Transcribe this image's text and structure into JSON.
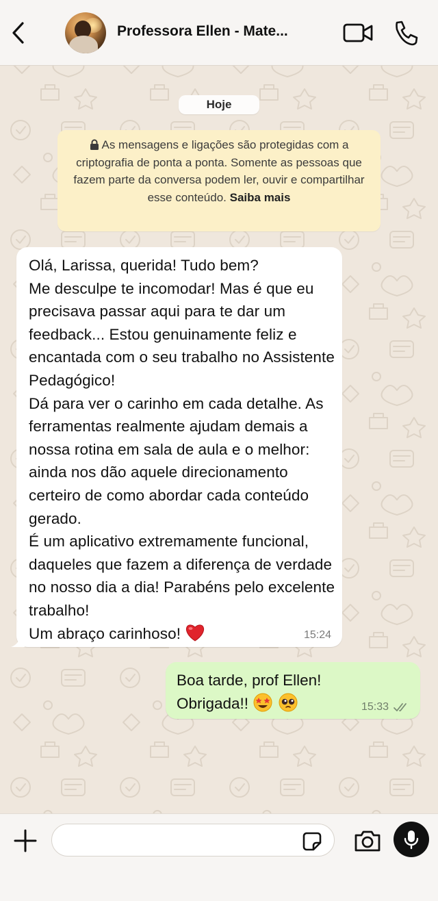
{
  "header": {
    "contact_name": "Professora Ellen - Mate...",
    "icons": [
      "back-arrow-icon",
      "video-call-icon",
      "phone-icon"
    ]
  },
  "chat": {
    "date_label": "Hoje",
    "encryption_notice": "As mensagens e ligações são protegidas com a criptografia de ponta a ponta. Somente as pessoas que fazem parte da conversa podem ler, ouvir e compartilhar esse conteúdo.",
    "encryption_link": "Saiba mais",
    "messages": [
      {
        "direction": "incoming",
        "text": "Olá, Larissa, querida! Tudo bem?\nMe desculpe te incomodar! Mas é que eu precisava passar aqui para te dar um feedback... Estou genuinamente feliz e encantada com o seu trabalho no Assistente Pedagógico!\nDá para ver o carinho em cada detalhe. As ferramentas realmente ajudam demais a nossa rotina em sala de aula e o melhor: ainda nos dão aquele direcionamento certeiro de como abordar cada conteúdo gerado.\nÉ um aplicativo extremamente funcional, daqueles que fazem a diferença de verdade no nosso dia a dia! Parabéns pelo excelente trabalho!\nUm abraço carinhoso! ",
        "emoji": "red-heart-emoji",
        "time": "15:24"
      },
      {
        "direction": "outgoing",
        "text": "Boa tarde, prof Ellen!\nObrigada!! ",
        "emojis": [
          "star-struck-emoji",
          "pleading-face-emoji"
        ],
        "time": "15:33",
        "status": "read"
      }
    ]
  },
  "composer": {
    "placeholder": "",
    "value": "",
    "icons": [
      "plus-icon",
      "sticker-icon",
      "camera-icon",
      "microphone-icon"
    ]
  },
  "colors": {
    "incoming_bubble": "#ffffff",
    "outgoing_bubble": "#dcf8c6",
    "notice_bg": "#fcf0c8",
    "chat_bg": "#efe7dd",
    "read_ticks": "#7a8b74"
  }
}
